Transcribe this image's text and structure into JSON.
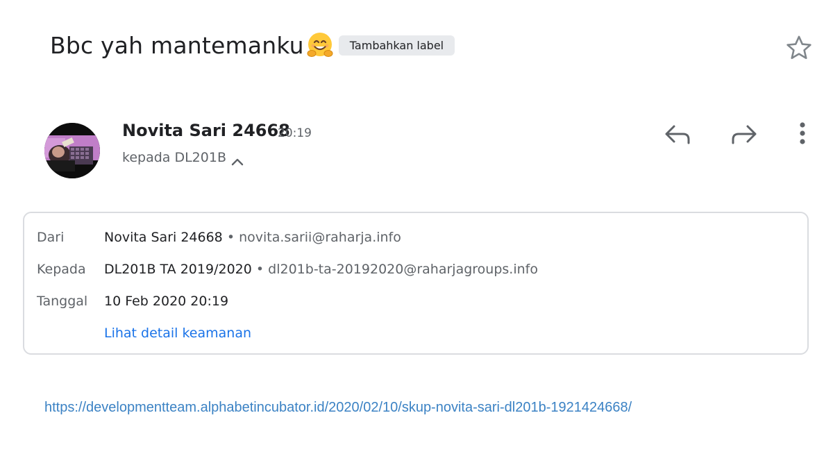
{
  "subject": {
    "title": "Bbc yah mantemanku",
    "emoji_icon": "hugging-face-emoji",
    "label_chip": "Tambahkan label"
  },
  "icons": {
    "star": "star-outline-icon",
    "reply": "reply-icon",
    "forward": "forward-icon",
    "more": "more-vertical-icon",
    "expand": "chevron-up-icon"
  },
  "message": {
    "sender_name": "Novita Sari 24668",
    "time": "20:19",
    "recipient_summary": "kepada DL201B"
  },
  "details": {
    "from_label": "Dari",
    "from_name": "Novita Sari 24668",
    "from_email": "novita.sarii@raharja.info",
    "to_label": "Kepada",
    "to_name": "DL201B TA 2019/2020",
    "to_email": "dl201b-ta-20192020@raharjagroups.info",
    "date_label": "Tanggal",
    "date_value": "10 Feb 2020 20:19",
    "security_link": "Lihat detail keamanan",
    "separator": "•"
  },
  "body": {
    "link": "https://developmentteam.alphabetincubator.id/2020/02/10/skup-novita-sari-dl201b-1921424668/"
  },
  "colors": {
    "text_primary": "#202124",
    "text_secondary": "#5f6368",
    "link_blue": "#1a73e8",
    "chip_bg": "#e8eaed",
    "card_border": "#dadce0"
  }
}
